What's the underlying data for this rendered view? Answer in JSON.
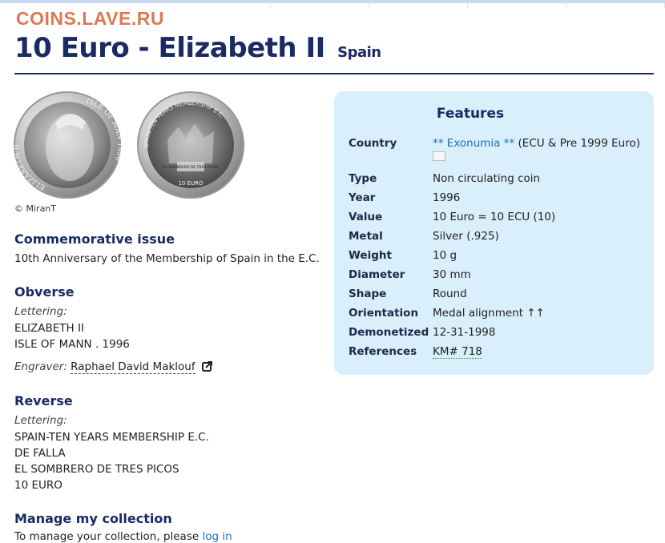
{
  "watermark": "COINS.LAVE.RU",
  "title": {
    "main": "10 Euro - Elizabeth II",
    "country": "Spain"
  },
  "coin_images": {
    "obverse_text_left": "ELIZABETH II",
    "obverse_text_right": "ISLE OF MAN 1996",
    "reverse_text_top": "SPAIN-TEN YEARS MEMBERSHIP E.C.",
    "reverse_text_mid": "EL SOMBRERO DE TRES PICOS",
    "reverse_text_bottom": "10 EURO",
    "credit": "© MiranT"
  },
  "commemorative": {
    "heading": "Commemorative issue",
    "text": "10th Anniversary of the Membership of Spain in the E.C."
  },
  "obverse": {
    "heading": "Obverse",
    "lettering_label": "Lettering:",
    "lines": [
      "ELIZABETH II",
      "ISLE OF MANN . 1996"
    ],
    "engraver_label": "Engraver:",
    "engraver_name": "Raphael David Maklouf"
  },
  "reverse": {
    "heading": "Reverse",
    "lettering_label": "Lettering:",
    "lines": [
      "SPAIN-TEN YEARS MEMBERSHIP E.C.",
      "DE FALLA",
      "EL SOMBRERO DE TRES PICOS",
      "10 EURO"
    ]
  },
  "collection": {
    "heading": "Manage my collection",
    "text": "To manage your collection, please",
    "link": "log in"
  },
  "features": {
    "heading": "Features",
    "country_label": "Country",
    "country_link": "** Exonumia **",
    "country_note": "(ECU & Pre 1999 Euro)",
    "rows": [
      {
        "label": "Type",
        "value": "Non circulating coin"
      },
      {
        "label": "Year",
        "value": "1996"
      },
      {
        "label": "Value",
        "value": "10 Euro = 10 ECU (10)"
      },
      {
        "label": "Metal",
        "value": "Silver (.925)"
      },
      {
        "label": "Weight",
        "value": "10 g"
      },
      {
        "label": "Diameter",
        "value": "30 mm"
      },
      {
        "label": "Shape",
        "value": "Round"
      },
      {
        "label": "Orientation",
        "value": "Medal alignment ↑↑"
      },
      {
        "label": "Demonetized",
        "value": "12-31-1998"
      }
    ],
    "references_label": "References",
    "references_value": "KM# 718"
  },
  "colors": {
    "heading": "#1a2a62",
    "link": "#1f6fb6",
    "panel": "#d9effb",
    "watermark": "#d97a52"
  }
}
